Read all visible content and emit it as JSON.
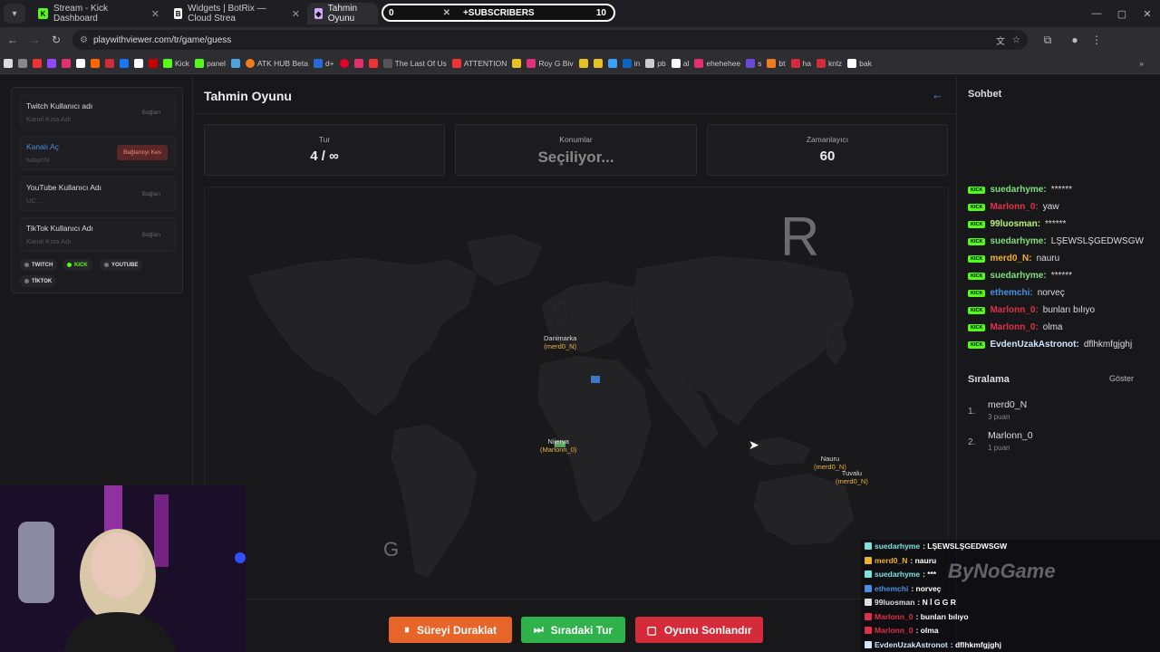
{
  "browser": {
    "tabs": [
      {
        "title": "Stream - Kick Dashboard",
        "icon": "kick-icon",
        "color": "#53fc18"
      },
      {
        "title": "Widgets | BotRix — Cloud Strea",
        "icon": "botrix-icon",
        "color": "#ffffff"
      },
      {
        "title": "Tahmin Oyunu",
        "icon": "game-icon",
        "color": "#d6a8ff"
      }
    ],
    "url": "playwithviewer.com/tr/game/guess",
    "bookmarks": [
      "Kick",
      "panel",
      "ATK HUB Beta",
      "d+",
      "The Last Of Us",
      "ATTENTION",
      "Roy G Biv",
      "in",
      "pb",
      "al",
      "ehehehee",
      "s",
      "bt",
      "ha",
      "knlz",
      "bak"
    ]
  },
  "sub_overlay": {
    "count": "0",
    "label": "+SUBSCRIBERS",
    "goal": "10"
  },
  "connections": {
    "items": [
      {
        "label": "Twitch Kullanıcı adı",
        "placeholder": "Kanal Kısa Adı",
        "action": "Bağlan"
      },
      {
        "label": "Kanalı Aç",
        "placeholder": "tulaychi",
        "action": "Bağlantıyı Kes"
      },
      {
        "label": "YouTube Kullanıcı Adı",
        "placeholder": "UC...",
        "action": "Bağlan"
      },
      {
        "label": "TikTok Kullanıcı Adı",
        "placeholder": "Kanal Kısa Adı",
        "action": "Bağlan"
      }
    ],
    "platforms": [
      "TWITCH",
      "KICK",
      "YOUTUBE",
      "TİKTOK"
    ]
  },
  "game": {
    "title": "Tahmin Oyunu",
    "stats": [
      {
        "label": "Tur",
        "value": "4 / ∞"
      },
      {
        "label": "Konumlar",
        "value": "Seçiliyor..."
      },
      {
        "label": "Zamanlayıcı",
        "value": "60"
      }
    ],
    "map_letters": {
      "top": "R",
      "bottom": "G"
    },
    "markers": [
      {
        "country": "Danimarka",
        "user": "(merd0_N)"
      },
      {
        "country": "Nijerya",
        "user": "(Marlonn_0)"
      },
      {
        "country": "Nauru",
        "user": "(merd0_N)"
      },
      {
        "country": "Tuvalu",
        "user": "(merd0_N)"
      }
    ],
    "buttons": {
      "pause": "Süreyi Duraklat",
      "next": "Sıradaki Tur",
      "end": "Oyunu Sonlandır"
    },
    "colors": {
      "pause": "#e8652a",
      "next": "#2fb14c",
      "end": "#d42b3a"
    }
  },
  "chat": {
    "title": "Sohbet",
    "badge": "KICK",
    "messages": [
      {
        "user": "suedarhyme:",
        "text": "******",
        "color": "#7ee07e"
      },
      {
        "user": "Marlonn_0:",
        "text": "yaw",
        "color": "#e0304a"
      },
      {
        "user": "99luosman:",
        "text": "******",
        "color": "#b6f07a"
      },
      {
        "user": "suedarhyme:",
        "text": "LŞEWSLŞGEDWSGW",
        "color": "#7ee07e"
      },
      {
        "user": "merd0_N:",
        "text": "nauru",
        "color": "#f0b030"
      },
      {
        "user": "suedarhyme:",
        "text": "******",
        "color": "#7ee07e"
      },
      {
        "user": "ethemchi:",
        "text": "norveç",
        "color": "#4a8fe0"
      },
      {
        "user": "Marlonn_0:",
        "text": "bunları bılıyo",
        "color": "#e0304a"
      },
      {
        "user": "Marlonn_0:",
        "text": "olma",
        "color": "#e0304a"
      },
      {
        "user": "EvdenUzakAstronot:",
        "text": "dflhkmfgjghj",
        "color": "#cfe8ff"
      }
    ]
  },
  "ranking": {
    "title": "Sıralama",
    "show_label": "Göster",
    "items": [
      {
        "rank": "1.",
        "name": "merd0_N",
        "points": "3 puan"
      },
      {
        "rank": "2.",
        "name": "Marlonn_0",
        "points": "1 puan"
      }
    ]
  },
  "overlay_chat": {
    "watermark": "ByNoGame",
    "lines": [
      {
        "user": "suedarhyme",
        "text": ": LŞEWSLŞGEDWSGW",
        "color": "#7ee0e0"
      },
      {
        "user": "merd0_N",
        "text": ": nauru",
        "color": "#f0b030"
      },
      {
        "user": "suedarhyme",
        "text": ": ***",
        "color": "#7ee0e0"
      },
      {
        "user": "ethemchi",
        "text": ": norveç",
        "color": "#4a8fe0"
      },
      {
        "user": "99luosman",
        "text": ": N  İ  G  G  R",
        "color": "#dddddd"
      },
      {
        "user": "Marlonn_0",
        "text": ": bunları bılıyo",
        "color": "#e0304a"
      },
      {
        "user": "Marlonn_0",
        "text": ": olma",
        "color": "#e0304a"
      },
      {
        "user": "EvdenUzakAstronot",
        "text": ": dflhkmfgjghj",
        "color": "#cfe8ff"
      }
    ]
  }
}
